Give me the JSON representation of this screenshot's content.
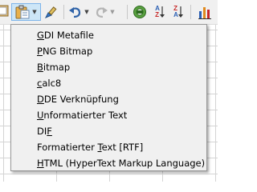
{
  "toolbar": {
    "buttons": [
      {
        "name": "clipboard-icon"
      },
      {
        "name": "paste-icon",
        "pressed": true
      },
      {
        "name": "clone-formatting-icon"
      },
      {
        "name": "undo-icon"
      },
      {
        "name": "redo-icon",
        "disabled": true
      },
      {
        "name": "spelling-icon"
      },
      {
        "name": "sort-ascending-icon",
        "top": "A",
        "bottom": "Z"
      },
      {
        "name": "sort-descending-icon",
        "top": "Z",
        "bottom": "A"
      },
      {
        "name": "insert-chart-icon"
      }
    ]
  },
  "paste_menu": {
    "items": [
      {
        "mnemonic": "G",
        "rest": "DI Metafile"
      },
      {
        "mnemonic": "P",
        "rest": "NG Bitmap"
      },
      {
        "mnemonic": "B",
        "rest": "itmap"
      },
      {
        "mnemonic": "c",
        "rest": "alc8"
      },
      {
        "mnemonic": "D",
        "rest": "DE Verknüpfung"
      },
      {
        "mnemonic": "U",
        "rest": "nformatierter Text"
      },
      {
        "pre": "DI",
        "mnemonic": "F",
        "rest": ""
      },
      {
        "pre": "Formatierter ",
        "mnemonic": "T",
        "rest": "ext [RTF]"
      },
      {
        "mnemonic": "H",
        "rest": "TML (HyperText Markup Language)"
      }
    ]
  },
  "colors": {
    "toolbar_bg": "#f0f0f0",
    "menu_bg": "#f0f0f0",
    "menu_border": "#979797",
    "pressed_bg": "#cde6f7",
    "pressed_border": "#7eb4ea",
    "grid": "#d4d4d4"
  }
}
